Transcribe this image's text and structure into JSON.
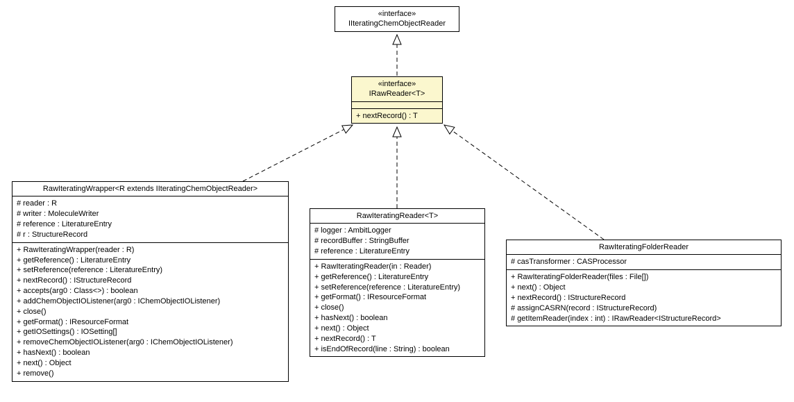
{
  "top_interface": {
    "stereotype": "«interface»",
    "name": "IIteratingChemObjectReader"
  },
  "raw_reader_interface": {
    "stereotype": "«interface»",
    "name": "IRawReader<T>",
    "methods": {
      "m0": "+ nextRecord() : T"
    }
  },
  "wrapper": {
    "name": "RawIteratingWrapper<R extends IIteratingChemObjectReader>",
    "fields": {
      "f0": "# reader : R",
      "f1": "# writer : MoleculeWriter",
      "f2": "# reference : LiteratureEntry",
      "f3": "# r : StructureRecord"
    },
    "methods": {
      "m0": "+ RawIteratingWrapper(reader : R)",
      "m1": "+ getReference() : LiteratureEntry",
      "m2": "+ setReference(reference : LiteratureEntry)",
      "m3": "+ nextRecord() : IStructureRecord",
      "m4": "+ accepts(arg0 : Class<>) : boolean",
      "m5": "+ addChemObjectIOListener(arg0 : IChemObjectIOListener)",
      "m6": "+ close()",
      "m7": "+ getFormat() : IResourceFormat",
      "m8": "+ getIOSettings() : IOSetting[]",
      "m9": "+ removeChemObjectIOListener(arg0 : IChemObjectIOListener)",
      "m10": "+ hasNext() : boolean",
      "m11": "+ next() : Object",
      "m12": "+ remove()"
    }
  },
  "reader": {
    "name": "RawIteratingReader<T>",
    "fields": {
      "f0": "# logger : AmbitLogger",
      "f1": "# recordBuffer : StringBuffer",
      "f2": "# reference : LiteratureEntry"
    },
    "methods": {
      "m0": "+ RawIteratingReader(in : Reader)",
      "m1": "+ getReference() : LiteratureEntry",
      "m2": "+ setReference(reference : LiteratureEntry)",
      "m3": "+ getFormat() : IResourceFormat",
      "m4": "+ close()",
      "m5": "+ hasNext() : boolean",
      "m6": "+ next() : Object",
      "m7": "+ nextRecord() : T",
      "m8": "+ isEndOfRecord(line : String) : boolean"
    }
  },
  "folder_reader": {
    "name": "RawIteratingFolderReader",
    "fields": {
      "f0": "# casTransformer : CASProcessor"
    },
    "methods": {
      "m0": "+ RawIteratingFolderReader(files : File[])",
      "m1": "+ next() : Object",
      "m2": "+ nextRecord() : IStructureRecord",
      "m3": "# assignCASRN(record : IStructureRecord)",
      "m4": "# getItemReader(index : int) : IRawReader<IStructureRecord>"
    }
  }
}
